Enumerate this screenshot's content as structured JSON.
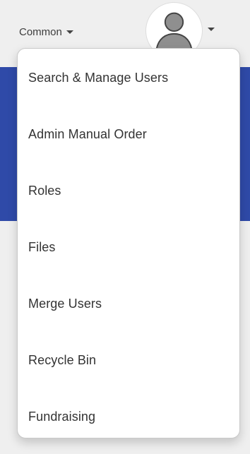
{
  "header": {
    "common_label": "Common"
  },
  "menu": {
    "items": [
      {
        "label": "Search & Manage Users"
      },
      {
        "label": "Admin Manual Order"
      },
      {
        "label": "Roles"
      },
      {
        "label": "Files"
      },
      {
        "label": "Merge Users"
      },
      {
        "label": "Recycle Bin"
      },
      {
        "label": "Fundraising"
      }
    ]
  },
  "icons": {
    "avatar": "user-avatar-icon",
    "common_caret": "chevron-down-icon",
    "avatar_caret": "chevron-down-icon"
  },
  "colors": {
    "page_bg": "#efefef",
    "accent_band": "#2f4aa8",
    "menu_bg": "#ffffff",
    "text": "#333333"
  }
}
